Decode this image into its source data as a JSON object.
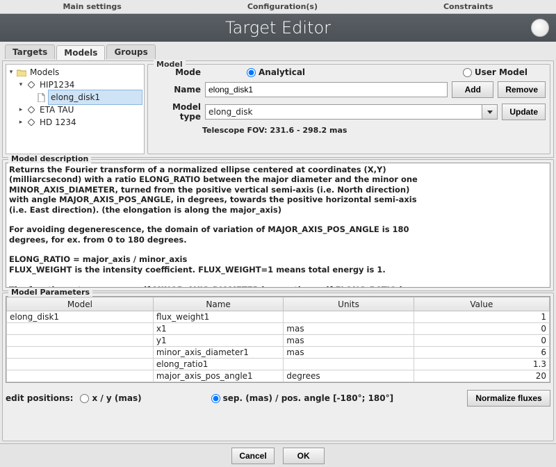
{
  "crumbs": {
    "main": "Main settings",
    "config": "Configuration(s)",
    "constraints": "Constraints"
  },
  "title": "Target Editor",
  "tabs": {
    "targets": "Targets",
    "models": "Models",
    "groups": "Groups"
  },
  "tree": {
    "root": "Models",
    "n0": "HIP1234",
    "n0c0": "elong_disk1",
    "n1": "ETA TAU",
    "n2": "HD 1234"
  },
  "model": {
    "legend": "Model",
    "mode_label": "Mode",
    "mode_analytical": "Analytical",
    "mode_user": "User Model",
    "name_label": "Name",
    "name_value": "elong_disk1",
    "add": "Add",
    "remove": "Remove",
    "type_label": "Model type",
    "type_value": "elong_disk",
    "update": "Update",
    "fov": "Telescope FOV: 231.6 - 298.2 mas"
  },
  "description": {
    "legend": "Model description",
    "text": "Returns the Fourier transform of a normalized ellipse centered at coordinates (X,Y)\n(milliarcsecond) with a ratio ELONG_RATIO between the major diameter and the minor one\nMINOR_AXIS_DIAMETER, turned from the positive vertical semi-axis (i.e. North direction)\nwith angle MAJOR_AXIS_POS_ANGLE, in degrees, towards the positive horizontal semi-axis\n(i.e. East direction). (the elongation is along the major_axis)\n\nFor avoiding degenerescence, the domain of variation of MAJOR_AXIS_POS_ANGLE is 180\ndegrees, for ex. from 0 to 180 degrees.\n\nELONG_RATIO = major_axis / minor_axis\nFLUX_WEIGHT is the intensity coefficient. FLUX_WEIGHT=1 means total energy is 1.\n\nThe function returns an error if MINOR_AXIS_DIAMETER is negative or if ELONG_RATIO is"
  },
  "params": {
    "legend": "Model Parameters",
    "headers": {
      "model": "Model",
      "name": "Name",
      "units": "Units",
      "value": "Value"
    },
    "rows": [
      {
        "model": "elong_disk1",
        "name": "flux_weight1",
        "units": "",
        "value": "1"
      },
      {
        "model": "",
        "name": "x1",
        "units": "mas",
        "value": "0"
      },
      {
        "model": "",
        "name": "y1",
        "units": "mas",
        "value": "0"
      },
      {
        "model": "",
        "name": "minor_axis_diameter1",
        "units": "mas",
        "value": "6"
      },
      {
        "model": "",
        "name": "elong_ratio1",
        "units": "",
        "value": "1.3"
      },
      {
        "model": "",
        "name": "major_axis_pos_angle1",
        "units": "degrees",
        "value": "20"
      }
    ]
  },
  "editpos": {
    "label": "edit positions:",
    "xy": "x / y (mas)",
    "sep": "sep. (mas) / pos. angle [-180°; 180°]",
    "normalize": "Normalize fluxes"
  },
  "footer": {
    "cancel": "Cancel",
    "ok": "OK"
  }
}
